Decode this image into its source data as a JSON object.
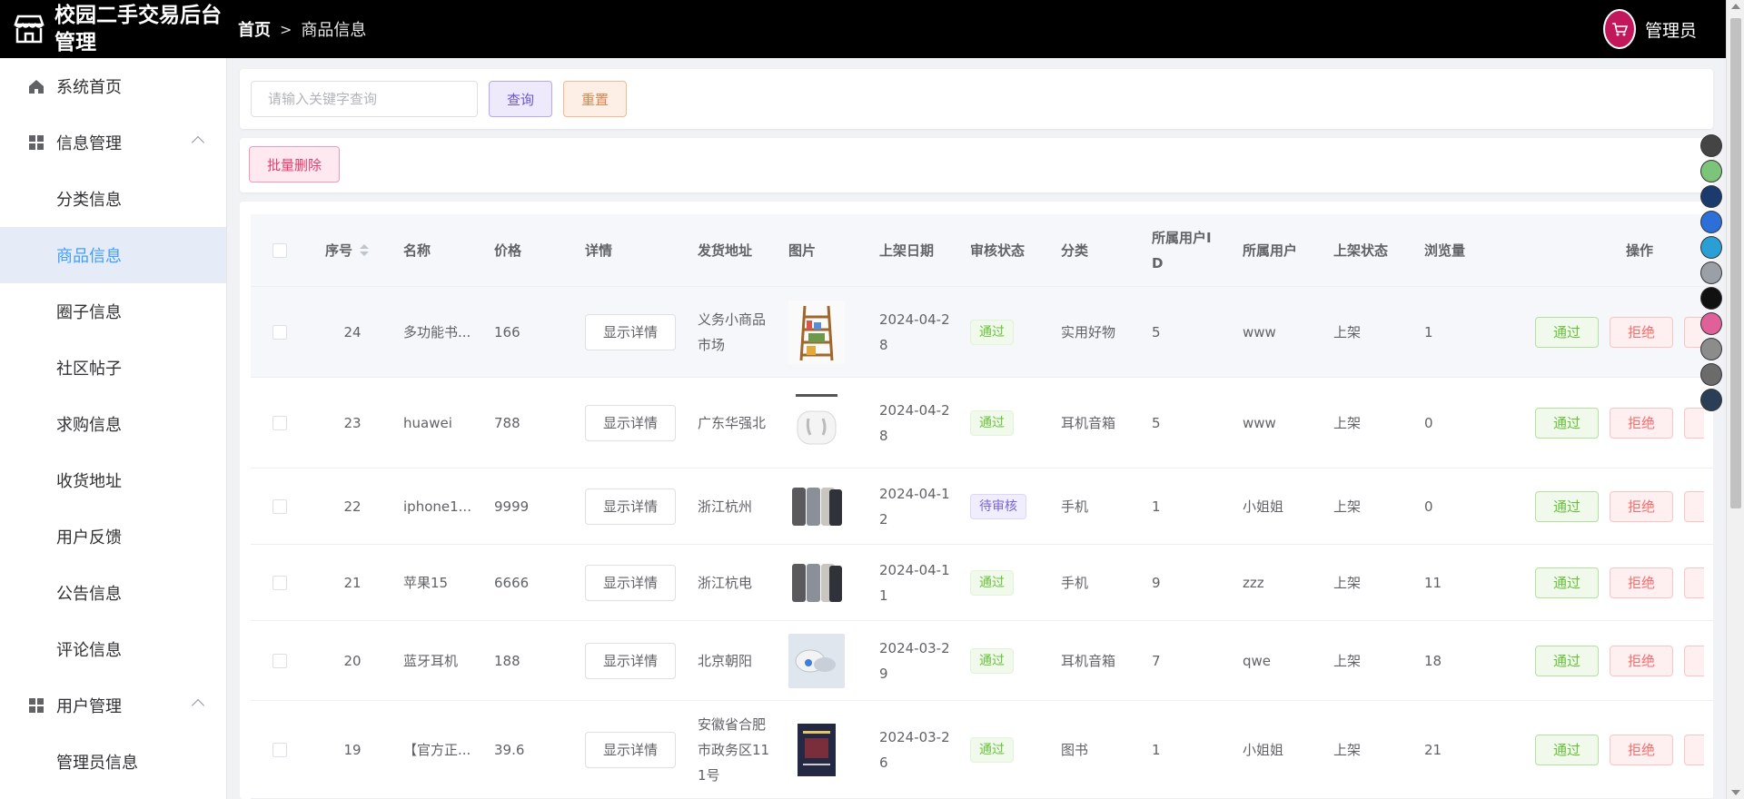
{
  "app": {
    "title": "校园二手交易后台管理"
  },
  "breadcrumb": {
    "home": "首页",
    "current": "商品信息"
  },
  "user": {
    "name": "管理员"
  },
  "sidebar": {
    "items": [
      {
        "label": "系统首页"
      },
      {
        "label": "信息管理"
      },
      {
        "label": "分类信息"
      },
      {
        "label": "商品信息"
      },
      {
        "label": "圈子信息"
      },
      {
        "label": "社区帖子"
      },
      {
        "label": "求购信息"
      },
      {
        "label": "收货地址"
      },
      {
        "label": "用户反馈"
      },
      {
        "label": "公告信息"
      },
      {
        "label": "评论信息"
      },
      {
        "label": "用户管理"
      },
      {
        "label": "管理员信息"
      }
    ]
  },
  "search": {
    "placeholder": "请输入关键字查询",
    "query_label": "查询",
    "reset_label": "重置"
  },
  "toolbar": {
    "batch_delete_label": "批量删除"
  },
  "table": {
    "columns": [
      "序号",
      "名称",
      "价格",
      "详情",
      "发货地址",
      "图片",
      "上架日期",
      "审核状态",
      "分类",
      "所属用户ID",
      "所属用户",
      "上架状态",
      "浏览量",
      "操作"
    ],
    "detail_label": "显示详情",
    "approve_label": "通过",
    "reject_label": "拒绝",
    "rows": [
      {
        "id": "24",
        "name": "多功能书...",
        "price": "166",
        "address": "义务小商品市场",
        "date": "2024-04-28",
        "status": "通过",
        "category": "实用好物",
        "user_id": "5",
        "user": "www",
        "shelf": "上架",
        "views": "1"
      },
      {
        "id": "23",
        "name": "huawei",
        "price": "788",
        "address": "广东华强北",
        "date": "2024-04-28",
        "status": "通过",
        "category": "耳机音箱",
        "user_id": "5",
        "user": "www",
        "shelf": "上架",
        "views": "0"
      },
      {
        "id": "22",
        "name": "iphone1...",
        "price": "9999",
        "address": "浙江杭州",
        "date": "2024-04-12",
        "status": "待审核",
        "category": "手机",
        "user_id": "1",
        "user": "小姐姐",
        "shelf": "上架",
        "views": "0"
      },
      {
        "id": "21",
        "name": "苹果15",
        "price": "6666",
        "address": "浙江杭电",
        "date": "2024-04-11",
        "status": "通过",
        "category": "手机",
        "user_id": "9",
        "user": "zzz",
        "shelf": "上架",
        "views": "11"
      },
      {
        "id": "20",
        "name": "蓝牙耳机",
        "price": "188",
        "address": "北京朝阳",
        "date": "2024-03-29",
        "status": "通过",
        "category": "耳机音箱",
        "user_id": "7",
        "user": "qwe",
        "shelf": "上架",
        "views": "18"
      },
      {
        "id": "19",
        "name": "【官方正...",
        "price": "39.6",
        "address": "安徽省合肥市政务区111号",
        "date": "2024-03-26",
        "status": "通过",
        "category": "图书",
        "user_id": "1",
        "user": "小姐姐",
        "shelf": "上架",
        "views": "21"
      }
    ]
  },
  "colors": {
    "active_menu_bg": "#e6ecf7",
    "active_menu_text": "#409eff",
    "header_bg": "#000000"
  }
}
